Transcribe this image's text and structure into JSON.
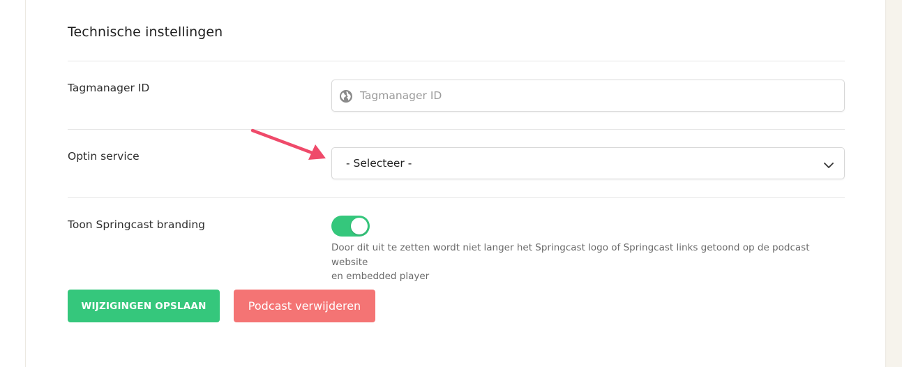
{
  "section": {
    "title": "Technische instellingen"
  },
  "tagmanager": {
    "label": "Tagmanager ID",
    "placeholder": "Tagmanager ID",
    "value": ""
  },
  "optin": {
    "label": "Optin service",
    "selected": "- Selecteer -"
  },
  "branding": {
    "label": "Toon Springcast branding",
    "enabled": true,
    "help_line1": "Door dit uit te zetten wordt niet langer het Springcast logo of Springcast links getoond op de podcast website",
    "help_line2": "en embedded player"
  },
  "actions": {
    "save_label": "WIJZIGINGEN OPSLAAN",
    "delete_label": "Podcast verwijderen"
  },
  "colors": {
    "accent_green": "#35c77c",
    "danger_red": "#f47474",
    "annotation_arrow": "#ef4a6a"
  },
  "icons": {
    "tagmanager_input_icon": "globe-icon",
    "select_icon": "chevron-down-icon",
    "annotation": "arrow-annotation"
  }
}
